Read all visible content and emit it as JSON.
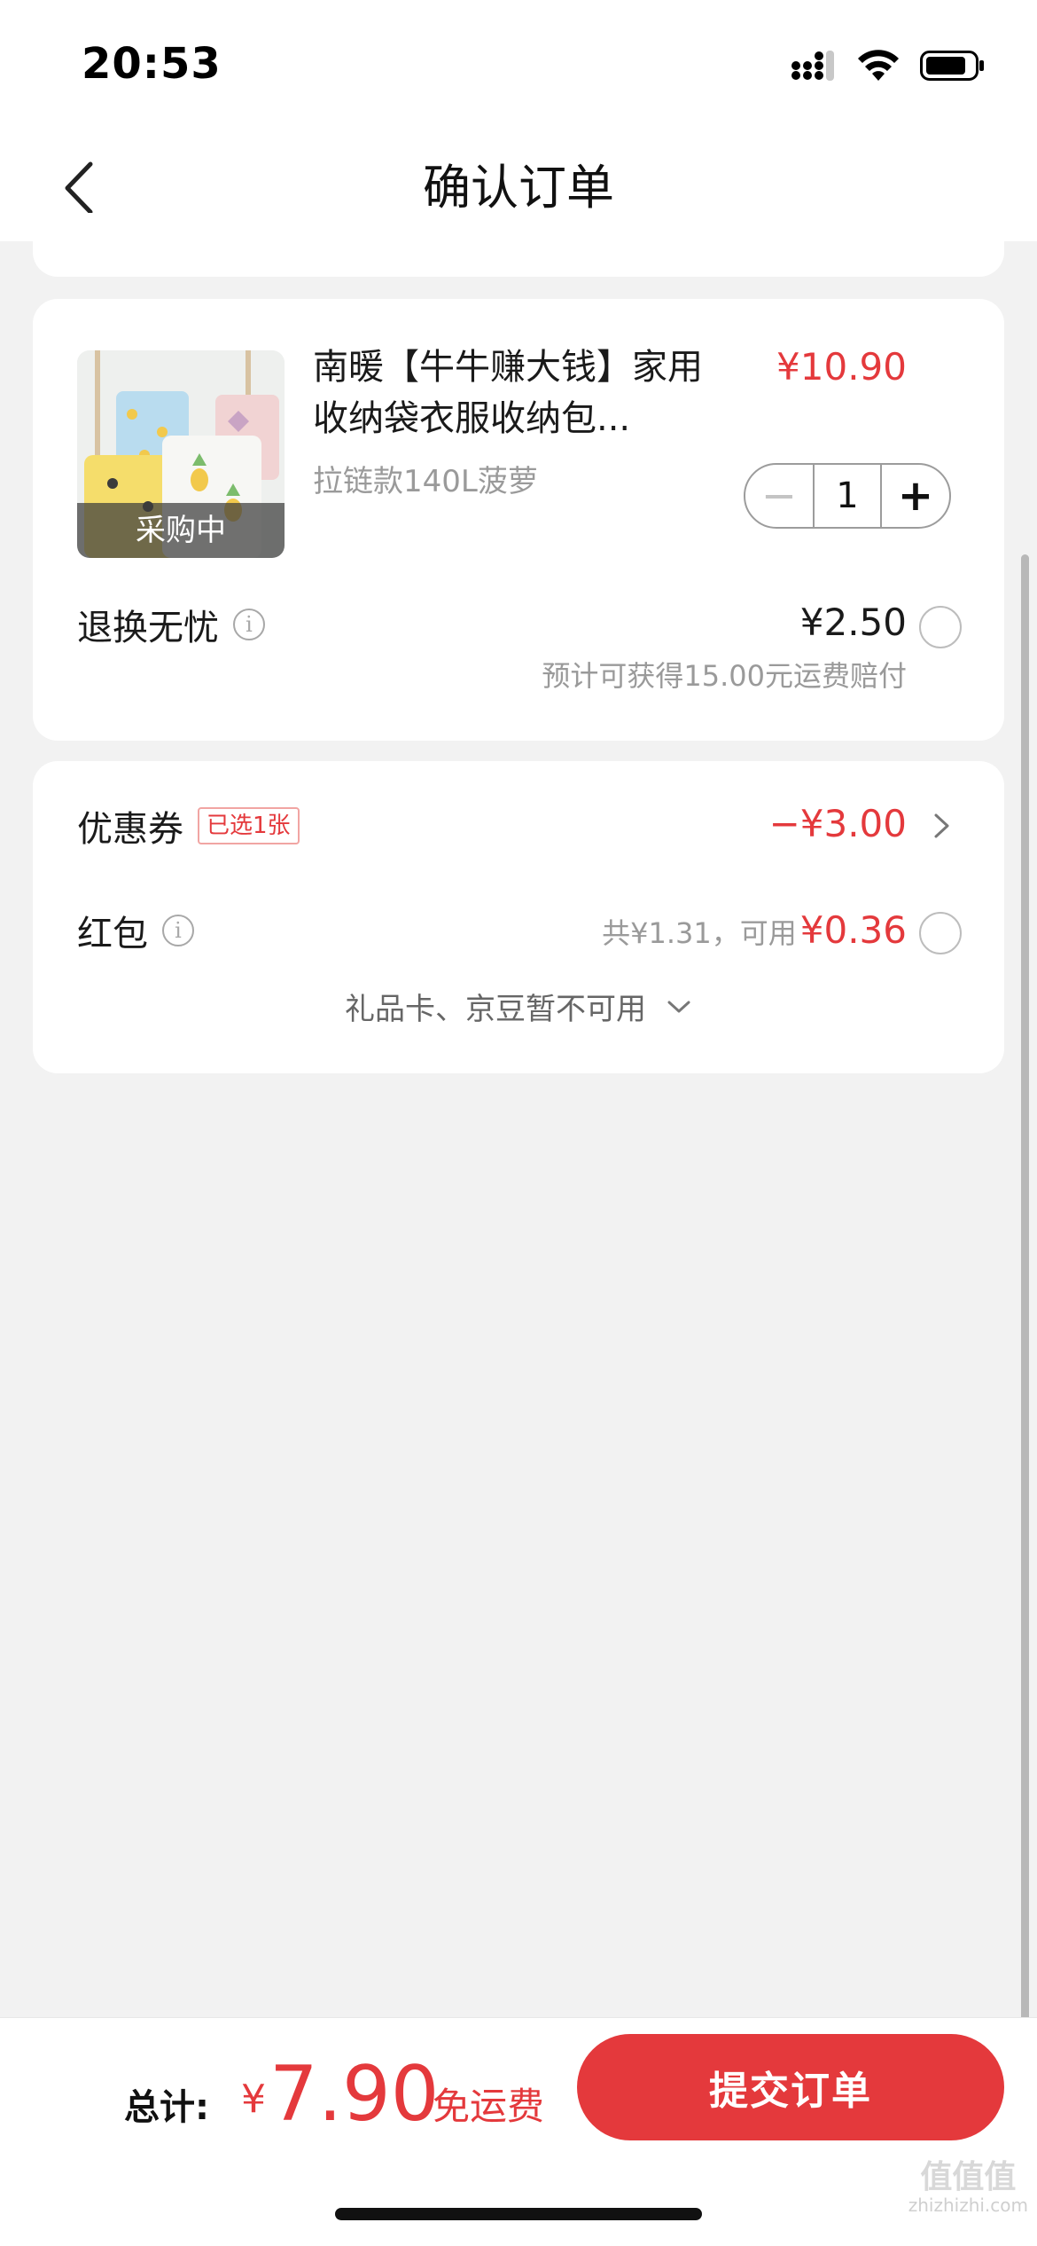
{
  "status_bar": {
    "time": "20:53"
  },
  "nav": {
    "title": "确认订单"
  },
  "product": {
    "title": "南暖【牛牛赚大钱】家用收纳袋衣服收纳包...",
    "price": "¥10.90",
    "sku": "拉链款140L菠萝",
    "thumb_badge": "采购中",
    "quantity": "1",
    "minus_label": "−",
    "plus_label": "+"
  },
  "return_service": {
    "label": "退换无忧",
    "price": "¥2.50",
    "note": "预计可获得15.00元运费赔付"
  },
  "coupon": {
    "label": "优惠券",
    "badge": "已选1张",
    "value": "−¥3.00"
  },
  "red_packet": {
    "label": "红包",
    "total_prefix": "共¥1.31，可用",
    "available": "¥0.36"
  },
  "gift_card": {
    "text": "礼品卡、京豆暂不可用"
  },
  "footer": {
    "total_label": "总计:",
    "currency": "¥",
    "total_amount": "7.90",
    "free_shipping": "免运费",
    "submit_label": "提交订单"
  },
  "watermark": {
    "logo": "值值值",
    "site": "zhizhizhi.com"
  },
  "colors": {
    "accent": "#e4393c",
    "background": "#f2f2f2",
    "card": "#ffffff"
  }
}
